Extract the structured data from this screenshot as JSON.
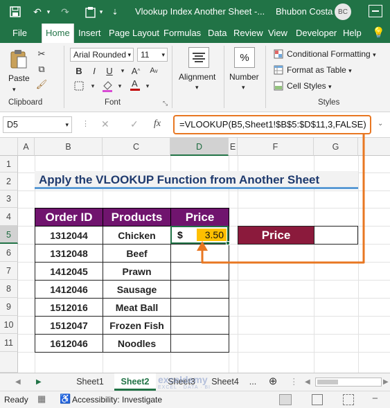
{
  "window": {
    "title": "Vlookup Index Another Sheet  -...",
    "user": "Bhubon Costa",
    "avatar_initials": "BC"
  },
  "menu": {
    "tabs": [
      "File",
      "Home",
      "Insert",
      "Page Layout",
      "Formulas",
      "Data",
      "Review",
      "View",
      "Developer",
      "Help"
    ],
    "active": "Home"
  },
  "ribbon": {
    "paste_label": "Paste",
    "font_name": "Arial Rounded",
    "font_size": "11",
    "alignment_label": "Alignment",
    "number_label": "Number",
    "percent_symbol": "%",
    "conditional_formatting": "Conditional Formatting",
    "format_as_table": "Format as Table",
    "cell_styles": "Cell Styles",
    "groups": {
      "clipboard": "Clipboard",
      "font": "Font",
      "styles": "Styles"
    }
  },
  "formula_bar": {
    "name_box": "D5",
    "fx": "fx",
    "formula": "=VLOOKUP(B5,Sheet1!$B$5:$D$11,3,FALSE)"
  },
  "grid": {
    "columns": [
      "A",
      "B",
      "C",
      "D",
      "E",
      "F",
      "G"
    ],
    "rows": [
      "1",
      "2",
      "3",
      "4",
      "5",
      "6",
      "7",
      "8",
      "9",
      "10",
      "11"
    ],
    "active_cell": "D5",
    "banner": "Apply the VLOOKUP Function from Another Sheet",
    "table": {
      "headers": [
        "Order ID",
        "Products",
        "Price"
      ],
      "rows": [
        [
          "1312044",
          "Chicken"
        ],
        [
          "1312048",
          "Beef"
        ],
        [
          "1412045",
          "Prawn"
        ],
        [
          "1412046",
          "Sausage"
        ],
        [
          "1512016",
          "Meat Ball"
        ],
        [
          "1512047",
          "Frozen Fish"
        ],
        [
          "1612046",
          "Noodles"
        ]
      ],
      "d5_currency": "$",
      "d5_value": "3.50"
    },
    "price_box_label": "Price"
  },
  "colors": {
    "excel_green": "#217346",
    "header_purple": "#70146e",
    "price_label_red": "#8b1a3c",
    "highlight_yellow": "#ffc000",
    "annotation_orange": "#e87722"
  },
  "sheets": {
    "tabs": [
      "Sheet1",
      "Sheet2",
      "Sheet3",
      "Sheet4"
    ],
    "active": "Sheet2",
    "more": "..."
  },
  "watermark": {
    "name": "exceldemy",
    "tagline": "EXCEL · DATA · BI"
  },
  "status": {
    "ready": "Ready",
    "accessibility": "Accessibility: Investigate"
  }
}
